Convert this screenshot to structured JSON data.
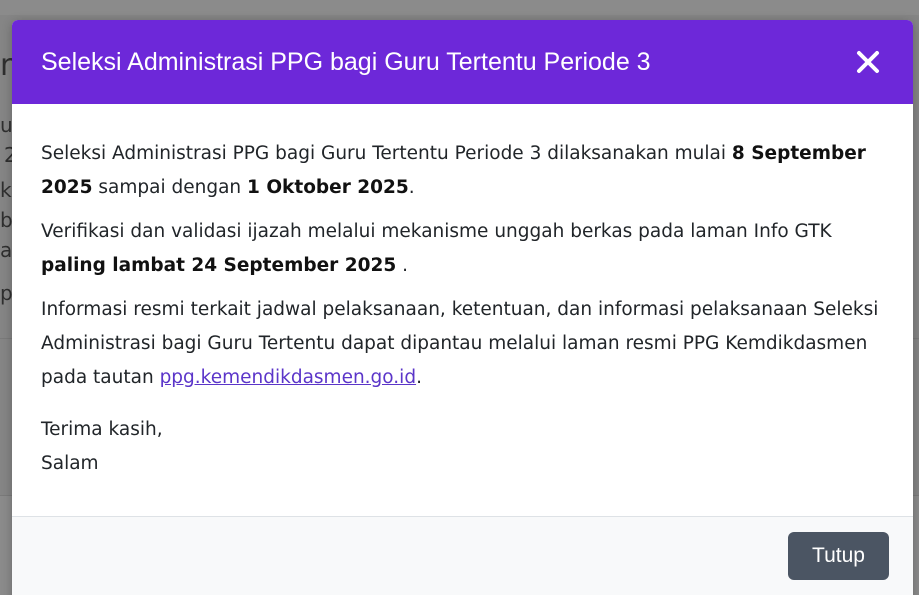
{
  "background": {
    "fragments": [
      "n",
      "u",
      "2",
      "k",
      "b",
      "a",
      "pa"
    ]
  },
  "modal": {
    "title": "Seleksi Administrasi PPG bagi Guru Tertentu Periode 3",
    "close_icon": "close-icon",
    "header_color": "#6d28d9",
    "body": {
      "p1_text1": "Seleksi Administrasi PPG bagi Guru Tertentu Periode 3 dilaksanakan mulai ",
      "p1_bold1": "8 September 2025",
      "p1_text2": " sampai dengan ",
      "p1_bold2": "1 Oktober 2025",
      "p1_text3": ".",
      "p2_text1": "Verifikasi dan validasi ijazah melalui mekanisme unggah berkas pada laman Info GTK ",
      "p2_bold1": "paling lambat 24 September 2025",
      "p2_text2": " .",
      "p3_text1": "Informasi resmi terkait jadwal pelaksanaan, ketentuan, dan informasi pelaksanaan Seleksi Administrasi bagi Guru Tertentu dapat dipantau melalui laman resmi PPG Kemdikdasmen pada tautan ",
      "p3_link": "ppg.kemendikdasmen.go.id",
      "p3_text2": ".",
      "closing_line1": "Terima kasih,",
      "closing_line2": "Salam"
    },
    "footer": {
      "close_button_label": "Tutup",
      "button_color": "#4b5563"
    },
    "link_color": "#5b35c9"
  }
}
